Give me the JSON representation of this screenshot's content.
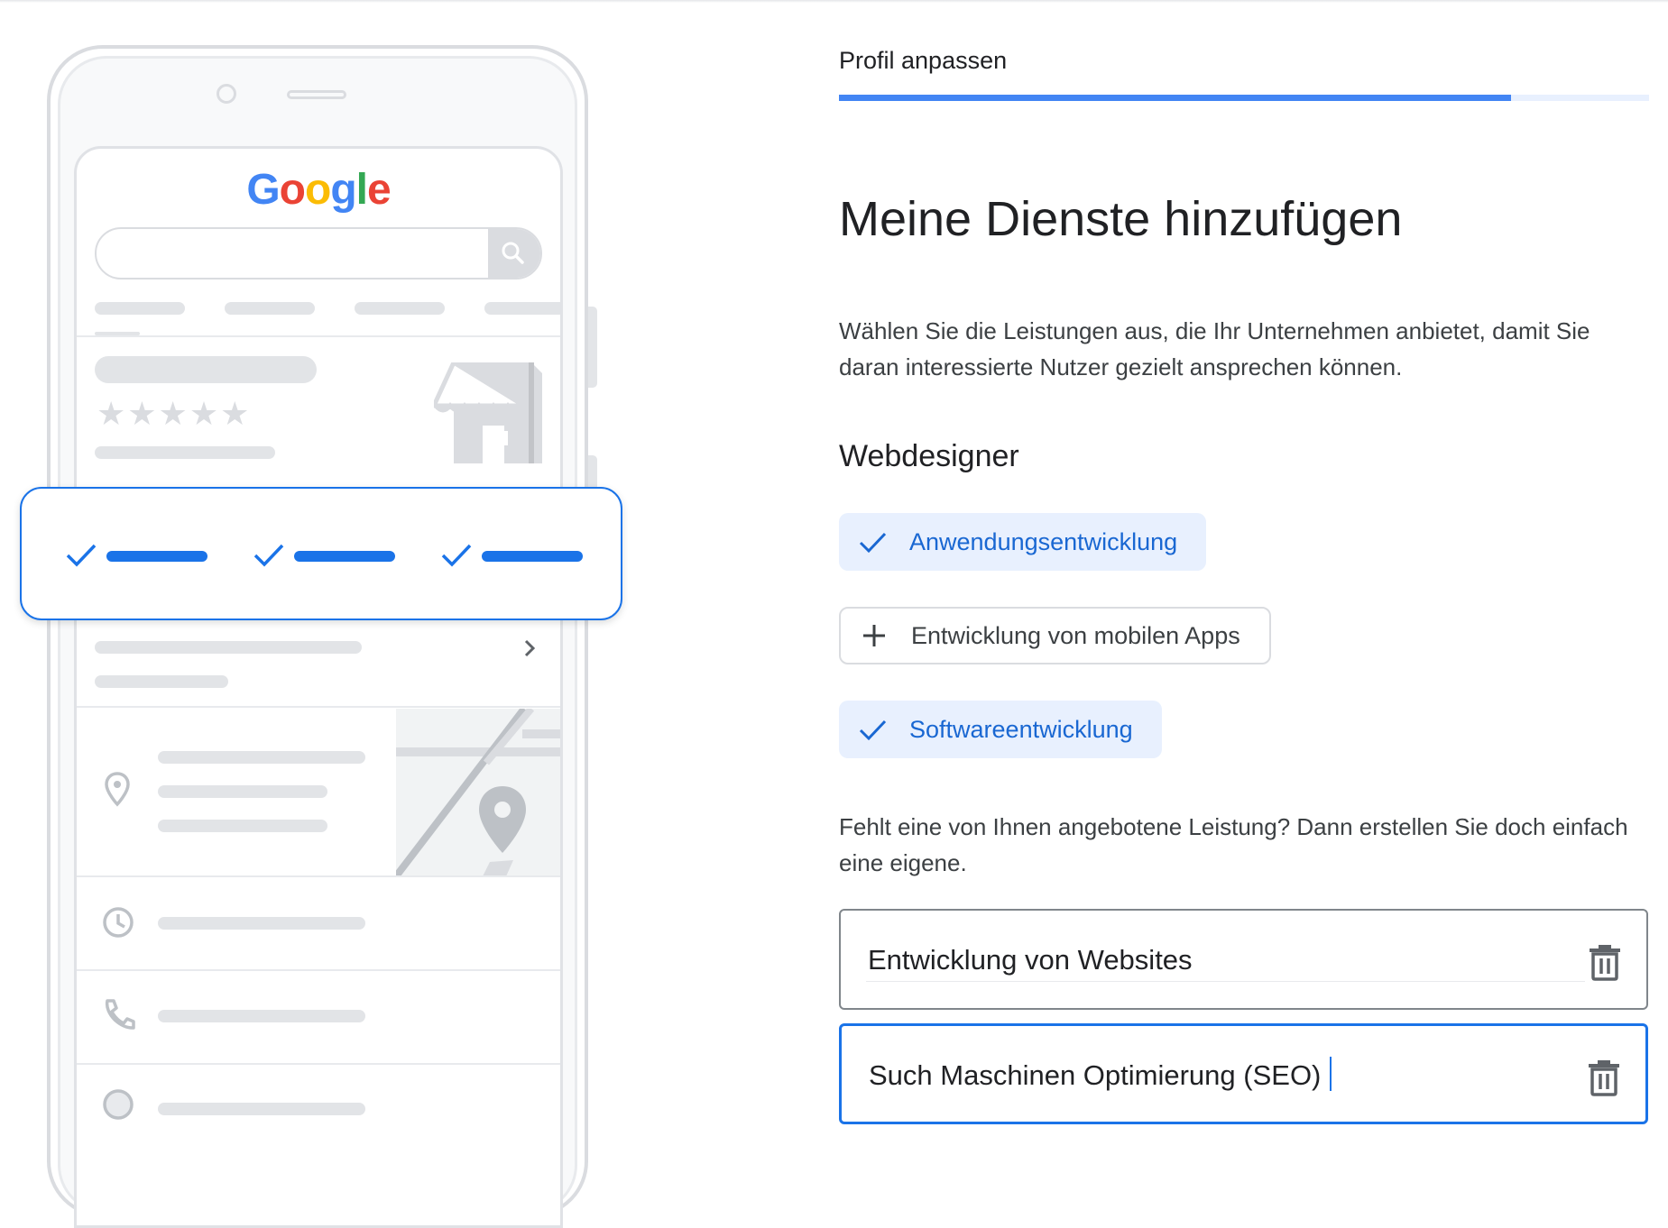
{
  "illustration": {
    "logo": {
      "letters": [
        {
          "char": "G",
          "color": "#4285f4"
        },
        {
          "char": "o",
          "color": "#ea4335"
        },
        {
          "char": "o",
          "color": "#fbbc05"
        },
        {
          "char": "g",
          "color": "#4285f4"
        },
        {
          "char": "l",
          "color": "#34a853"
        },
        {
          "char": "e",
          "color": "#ea4335"
        }
      ]
    },
    "stars": "★★★★★",
    "accent_color": "#1a73e8"
  },
  "header": {
    "step_label": "Profil anpassen",
    "progress_fraction": 0.83
  },
  "main": {
    "title": "Meine Dienste hinzufügen",
    "description": "Wählen Sie die Leistungen aus, die Ihr Unternehmen anbietet, damit Sie daran interessierte Nutzer gezielt ansprechen können.",
    "category": "Webdesigner",
    "services": [
      {
        "label": "Anwendungsentwicklung",
        "selected": true,
        "icon": "check-icon"
      },
      {
        "label": "Entwicklung von mobilen Apps",
        "selected": false,
        "icon": "plus-icon"
      },
      {
        "label": "Softwareentwicklung",
        "selected": true,
        "icon": "check-icon"
      }
    ],
    "custom_hint": "Fehlt eine von Ihnen angebotene Leistung? Dann erstellen Sie doch einfach eine eigene.",
    "custom_services": [
      {
        "value": "Entwicklung von Websites",
        "focused": false,
        "icon": "trash-icon"
      },
      {
        "value": "Such Maschinen Optimierung (SEO)",
        "focused": true,
        "icon": "trash-icon"
      }
    ]
  },
  "colors": {
    "primary": "#1a73e8",
    "chip_selected_bg": "#e8f0fe",
    "progress": "#4285f4"
  }
}
